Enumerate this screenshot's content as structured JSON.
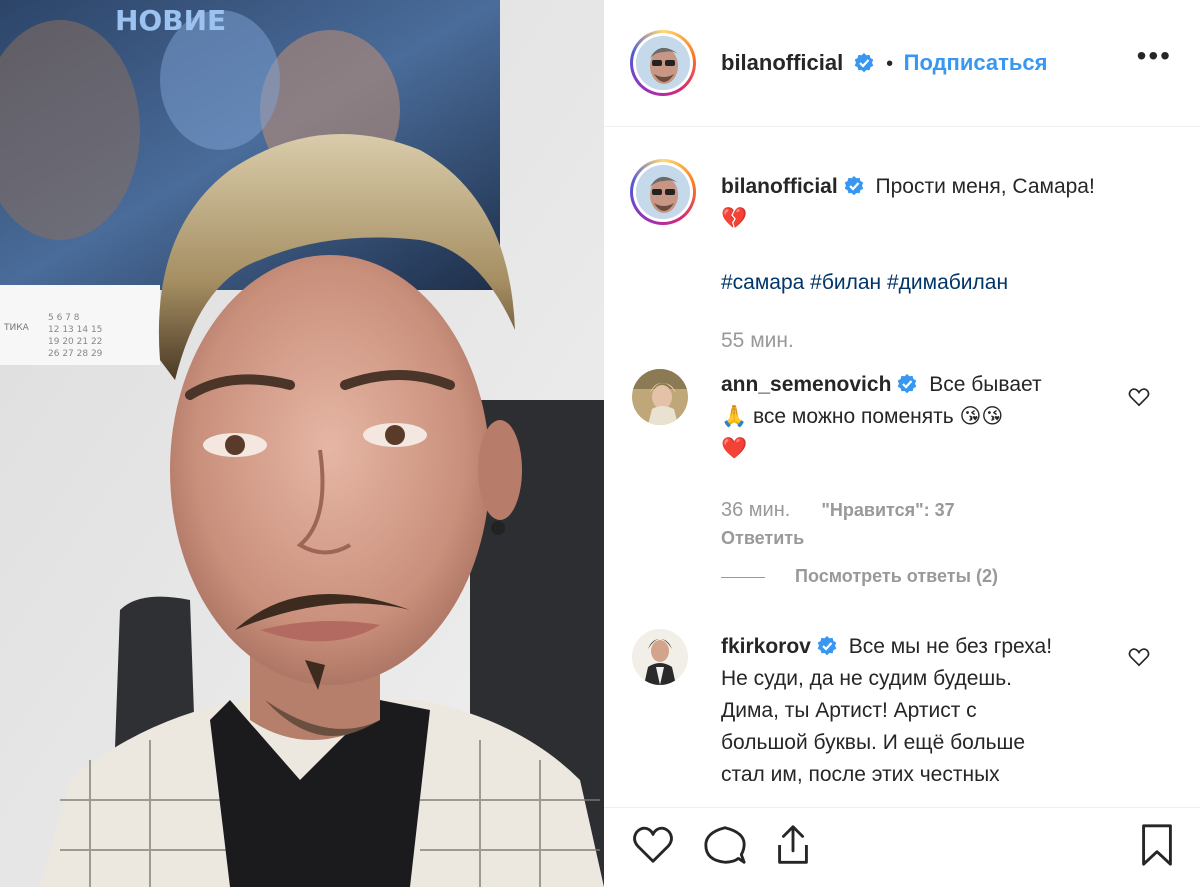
{
  "post": {
    "username": "bilanofficial",
    "follow_label": "Подписаться",
    "separator": "•",
    "more_label": "•••"
  },
  "caption": {
    "username": "bilanofficial",
    "text": "Прости меня, Самара!",
    "emoji": "💔",
    "hashtags": "#самара #билан #димабилан",
    "time": "55 мин."
  },
  "comments": [
    {
      "username": "ann_semenovich",
      "text_line1": "Все бывает",
      "text_line2_emoji": "🙏",
      "text_line2": "все можно поменять",
      "text_line2_tail": "😘😘",
      "text_line3": "❤️",
      "time": "36 мин.",
      "likes": "\"Нравится\": 37",
      "reply_label": "Ответить",
      "view_replies": "Посмотреть ответы (2)"
    },
    {
      "username": "fkirkorov",
      "lines": [
        "Все мы не без греха!",
        "Не суди, да не судим будешь.",
        "Дима, ты Артист! Артист с",
        "большой буквы. И ещё больше",
        "стал им, после этих честных"
      ]
    }
  ],
  "photo": {
    "calendar_label": "ТИКА",
    "calendar_rows": [
      "5  6  7  8",
      "12 13 14 15",
      "19 20 21 22",
      "26 27 28 29"
    ],
    "poster_text": "НОВИЕ"
  },
  "icons": {
    "like": "heart-outline-icon",
    "comment": "speech-bubble-icon",
    "share": "share-upload-icon",
    "save": "bookmark-icon"
  }
}
